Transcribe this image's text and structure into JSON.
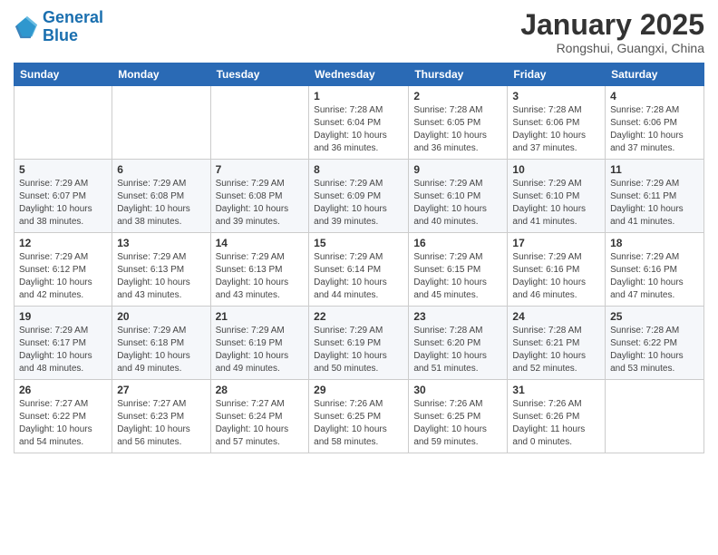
{
  "logo": {
    "line1": "General",
    "line2": "Blue"
  },
  "title": "January 2025",
  "subtitle": "Rongshui, Guangxi, China",
  "days_of_week": [
    "Sunday",
    "Monday",
    "Tuesday",
    "Wednesday",
    "Thursday",
    "Friday",
    "Saturday"
  ],
  "weeks": [
    [
      {
        "day": "",
        "info": ""
      },
      {
        "day": "",
        "info": ""
      },
      {
        "day": "",
        "info": ""
      },
      {
        "day": "1",
        "info": "Sunrise: 7:28 AM\nSunset: 6:04 PM\nDaylight: 10 hours and 36 minutes."
      },
      {
        "day": "2",
        "info": "Sunrise: 7:28 AM\nSunset: 6:05 PM\nDaylight: 10 hours and 36 minutes."
      },
      {
        "day": "3",
        "info": "Sunrise: 7:28 AM\nSunset: 6:06 PM\nDaylight: 10 hours and 37 minutes."
      },
      {
        "day": "4",
        "info": "Sunrise: 7:28 AM\nSunset: 6:06 PM\nDaylight: 10 hours and 37 minutes."
      }
    ],
    [
      {
        "day": "5",
        "info": "Sunrise: 7:29 AM\nSunset: 6:07 PM\nDaylight: 10 hours and 38 minutes."
      },
      {
        "day": "6",
        "info": "Sunrise: 7:29 AM\nSunset: 6:08 PM\nDaylight: 10 hours and 38 minutes."
      },
      {
        "day": "7",
        "info": "Sunrise: 7:29 AM\nSunset: 6:08 PM\nDaylight: 10 hours and 39 minutes."
      },
      {
        "day": "8",
        "info": "Sunrise: 7:29 AM\nSunset: 6:09 PM\nDaylight: 10 hours and 39 minutes."
      },
      {
        "day": "9",
        "info": "Sunrise: 7:29 AM\nSunset: 6:10 PM\nDaylight: 10 hours and 40 minutes."
      },
      {
        "day": "10",
        "info": "Sunrise: 7:29 AM\nSunset: 6:10 PM\nDaylight: 10 hours and 41 minutes."
      },
      {
        "day": "11",
        "info": "Sunrise: 7:29 AM\nSunset: 6:11 PM\nDaylight: 10 hours and 41 minutes."
      }
    ],
    [
      {
        "day": "12",
        "info": "Sunrise: 7:29 AM\nSunset: 6:12 PM\nDaylight: 10 hours and 42 minutes."
      },
      {
        "day": "13",
        "info": "Sunrise: 7:29 AM\nSunset: 6:13 PM\nDaylight: 10 hours and 43 minutes."
      },
      {
        "day": "14",
        "info": "Sunrise: 7:29 AM\nSunset: 6:13 PM\nDaylight: 10 hours and 43 minutes."
      },
      {
        "day": "15",
        "info": "Sunrise: 7:29 AM\nSunset: 6:14 PM\nDaylight: 10 hours and 44 minutes."
      },
      {
        "day": "16",
        "info": "Sunrise: 7:29 AM\nSunset: 6:15 PM\nDaylight: 10 hours and 45 minutes."
      },
      {
        "day": "17",
        "info": "Sunrise: 7:29 AM\nSunset: 6:16 PM\nDaylight: 10 hours and 46 minutes."
      },
      {
        "day": "18",
        "info": "Sunrise: 7:29 AM\nSunset: 6:16 PM\nDaylight: 10 hours and 47 minutes."
      }
    ],
    [
      {
        "day": "19",
        "info": "Sunrise: 7:29 AM\nSunset: 6:17 PM\nDaylight: 10 hours and 48 minutes."
      },
      {
        "day": "20",
        "info": "Sunrise: 7:29 AM\nSunset: 6:18 PM\nDaylight: 10 hours and 49 minutes."
      },
      {
        "day": "21",
        "info": "Sunrise: 7:29 AM\nSunset: 6:19 PM\nDaylight: 10 hours and 49 minutes."
      },
      {
        "day": "22",
        "info": "Sunrise: 7:29 AM\nSunset: 6:19 PM\nDaylight: 10 hours and 50 minutes."
      },
      {
        "day": "23",
        "info": "Sunrise: 7:28 AM\nSunset: 6:20 PM\nDaylight: 10 hours and 51 minutes."
      },
      {
        "day": "24",
        "info": "Sunrise: 7:28 AM\nSunset: 6:21 PM\nDaylight: 10 hours and 52 minutes."
      },
      {
        "day": "25",
        "info": "Sunrise: 7:28 AM\nSunset: 6:22 PM\nDaylight: 10 hours and 53 minutes."
      }
    ],
    [
      {
        "day": "26",
        "info": "Sunrise: 7:27 AM\nSunset: 6:22 PM\nDaylight: 10 hours and 54 minutes."
      },
      {
        "day": "27",
        "info": "Sunrise: 7:27 AM\nSunset: 6:23 PM\nDaylight: 10 hours and 56 minutes."
      },
      {
        "day": "28",
        "info": "Sunrise: 7:27 AM\nSunset: 6:24 PM\nDaylight: 10 hours and 57 minutes."
      },
      {
        "day": "29",
        "info": "Sunrise: 7:26 AM\nSunset: 6:25 PM\nDaylight: 10 hours and 58 minutes."
      },
      {
        "day": "30",
        "info": "Sunrise: 7:26 AM\nSunset: 6:25 PM\nDaylight: 10 hours and 59 minutes."
      },
      {
        "day": "31",
        "info": "Sunrise: 7:26 AM\nSunset: 6:26 PM\nDaylight: 11 hours and 0 minutes."
      },
      {
        "day": "",
        "info": ""
      }
    ]
  ]
}
